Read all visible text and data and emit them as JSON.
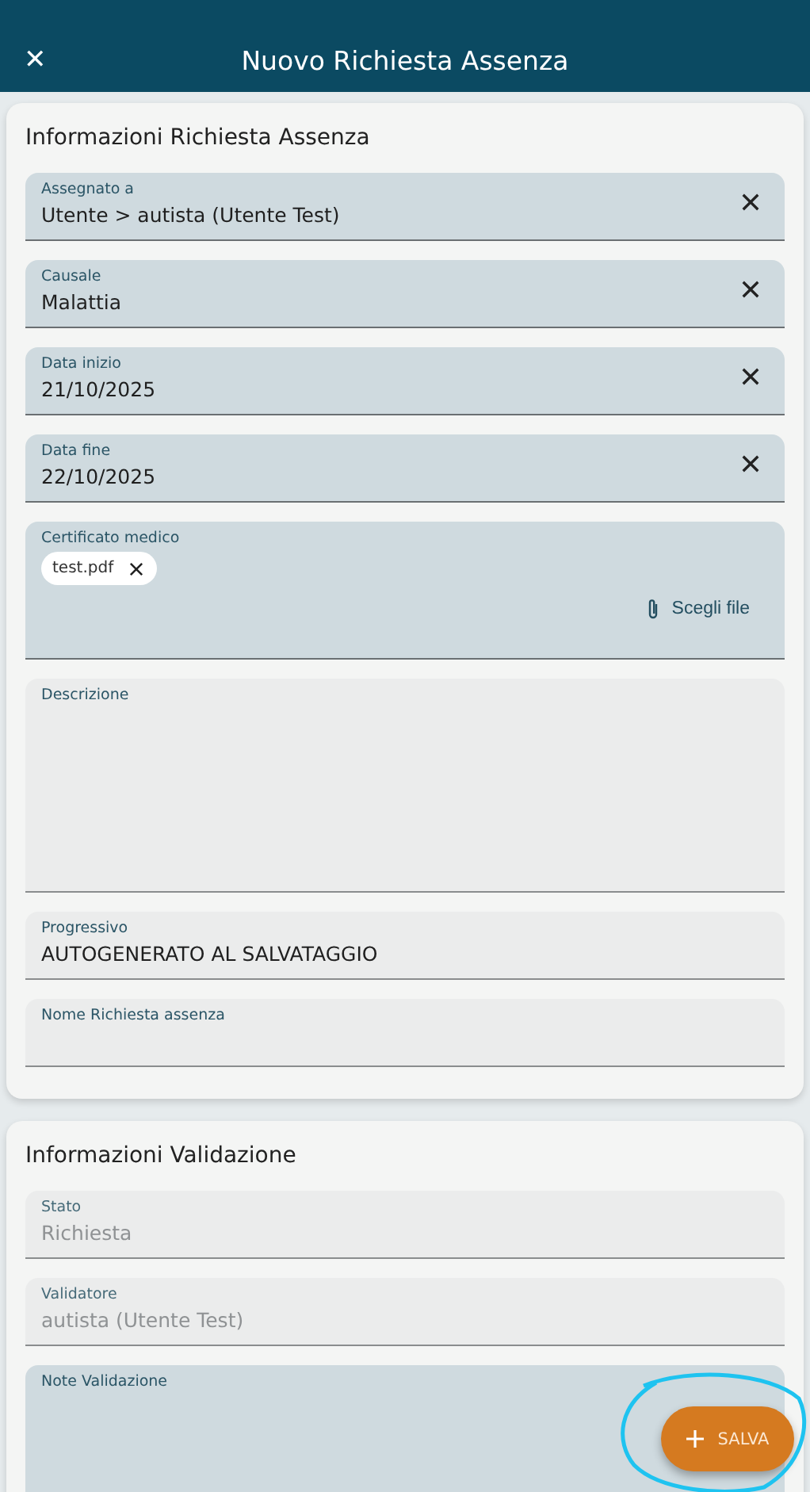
{
  "header": {
    "close_icon": "✕",
    "title": "Nuovo Richiesta Assenza"
  },
  "sections": [
    {
      "title": "Informazioni Richiesta Assenza",
      "fields": [
        {
          "kind": "text",
          "label": "Assegnato a",
          "value": "Utente > autista (Utente Test)",
          "clearable": true,
          "active": true,
          "disabled": false
        },
        {
          "kind": "text",
          "label": "Causale",
          "value": "Malattia",
          "clearable": true,
          "active": true,
          "disabled": false
        },
        {
          "kind": "text",
          "label": "Data inizio",
          "value": "21/10/2025",
          "clearable": true,
          "active": true,
          "disabled": false
        },
        {
          "kind": "text",
          "label": "Data fine",
          "value": "22/10/2025",
          "clearable": true,
          "active": true,
          "disabled": false
        },
        {
          "kind": "file",
          "label": "Certificato medico",
          "chips": [
            "test.pdf"
          ],
          "button": "Scegli file",
          "active": true,
          "disabled": false
        },
        {
          "kind": "textarea",
          "label": "Descrizione",
          "active": false
        },
        {
          "kind": "text",
          "label": "Progressivo",
          "value": "AUTOGENERATO AL SALVATAGGIO",
          "clearable": false,
          "active": false,
          "disabled": false
        },
        {
          "kind": "text",
          "label": "Nome Richiesta assenza",
          "clearable": false,
          "active": false
        }
      ]
    },
    {
      "title": "Informazioni Validazione",
      "fields": [
        {
          "kind": "text",
          "label": "Stato",
          "value": "Richiesta",
          "clearable": false,
          "active": false,
          "disabled": true
        },
        {
          "kind": "text",
          "label": "Validatore",
          "value": "autista (Utente Test)",
          "clearable": false,
          "active": false,
          "disabled": true
        },
        {
          "kind": "textarea",
          "label": "Note Validazione",
          "active": true
        }
      ]
    }
  ],
  "fab": {
    "label": "SALVA"
  }
}
